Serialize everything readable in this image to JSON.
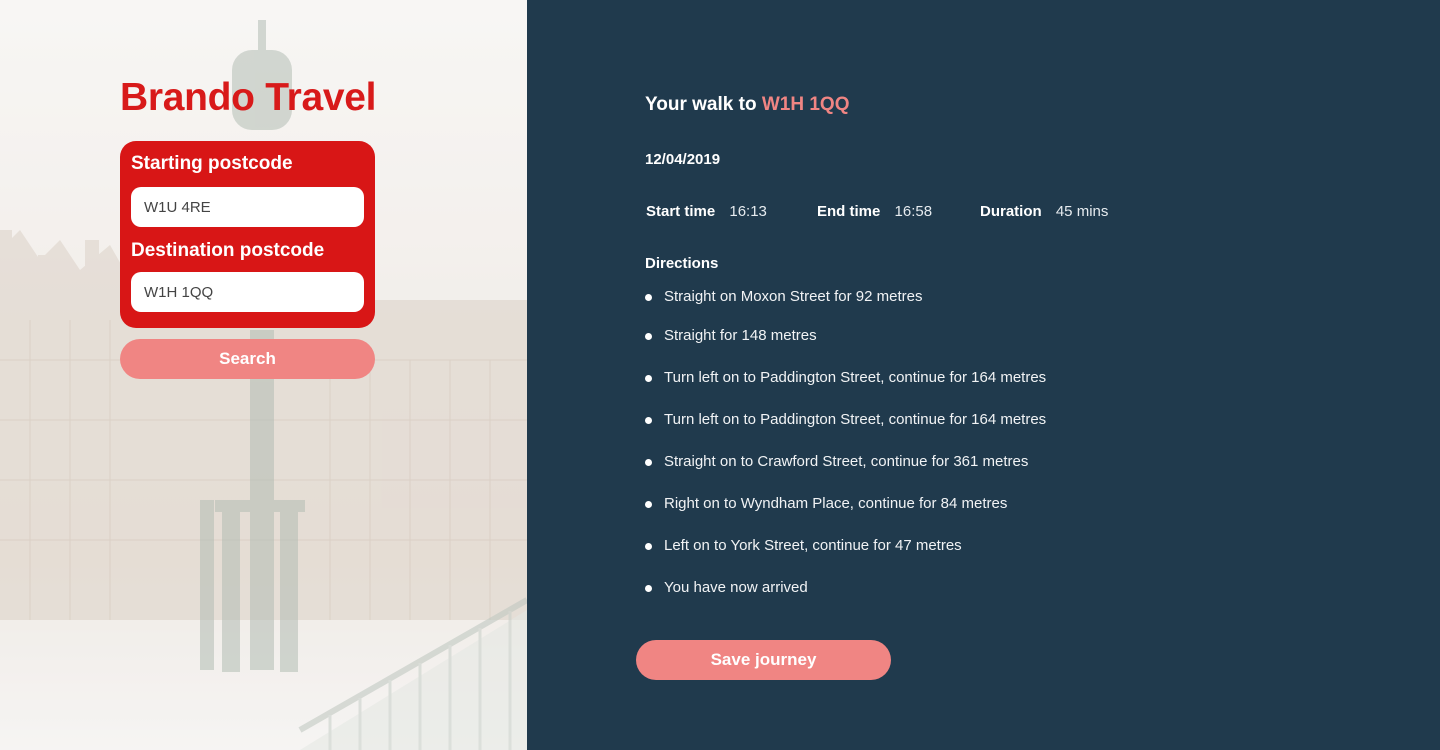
{
  "brand": {
    "name": "Brando Travel"
  },
  "form": {
    "start_label": "Starting postcode",
    "start_value": "W1U 4RE",
    "dest_label": "Destination postcode",
    "dest_value": "W1H 1QQ",
    "search_label": "Search"
  },
  "journey": {
    "title_prefix": "Your walk to",
    "destination": "W1H 1QQ",
    "date": "12/04/2019",
    "start_time_label": "Start time",
    "start_time": "16:13",
    "end_time_label": "End time",
    "end_time": "16:58",
    "duration_label": "Duration",
    "duration": "45 mins",
    "directions_label": "Directions",
    "steps": [
      "Straight on Moxon Street for 92 metres",
      "Straight for 148 metres",
      "Turn left on to Paddington Street, continue for 164 metres",
      "Turn left on to Paddington Street, continue for 164 metres",
      "Straight on to Crawford Street, continue for 361 metres",
      "Right on to Wyndham Place, continue for 84 metres",
      "Left on to York Street, continue for 47 metres",
      "You have now arrived"
    ],
    "save_label": "Save journey"
  },
  "colors": {
    "brand_red": "#d81616",
    "accent_pink": "#f08583",
    "panel_navy": "#203a4d"
  }
}
